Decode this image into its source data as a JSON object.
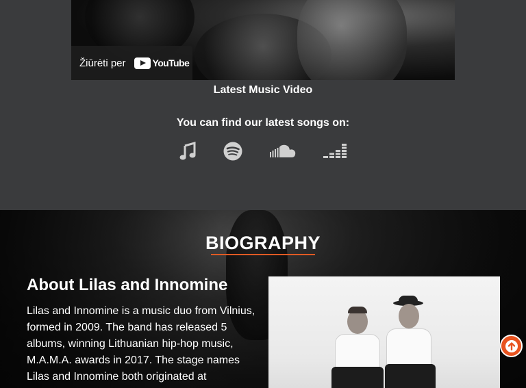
{
  "video": {
    "watch_label": "Žiūrėti per",
    "youtube_text": "YouTube",
    "caption": "Latest Music Video"
  },
  "songs": {
    "caption": "You can find our latest songs on:",
    "platforms": [
      {
        "icon": "apple-music-icon"
      },
      {
        "icon": "spotify-icon"
      },
      {
        "icon": "soundcloud-icon"
      },
      {
        "icon": "deezer-icon"
      }
    ]
  },
  "biography": {
    "title": "BIOGRAPHY",
    "about_title": "About Lilas and Innomine",
    "about_text": "Lilas and Innomine is a music duo from Vilnius, formed in 2009. The band has released 5 albums, winning Lithuanian hip-hop music, M.A.M.A. awards in 2017. The stage names Lilas and Innomine both originated at"
  },
  "colors": {
    "accent": "#e05a24",
    "background": "#3a3b3d",
    "icon": "#d0d0d0"
  }
}
